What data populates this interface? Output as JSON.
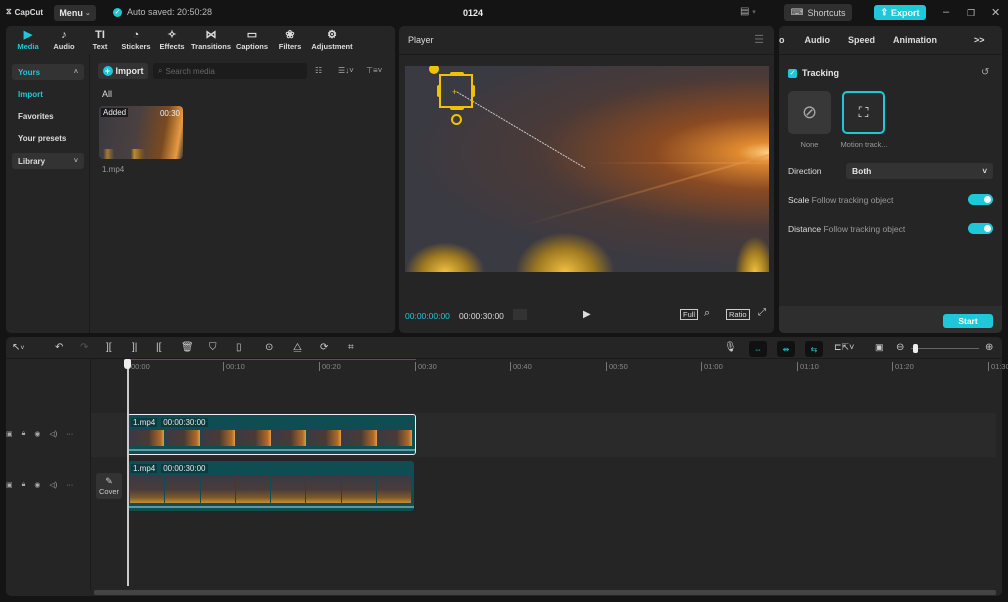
{
  "app": {
    "logo": "CapCut",
    "menu_label": "Menu",
    "autosave": "Auto saved: 20:50:28",
    "project_title": "0124",
    "shortcuts_label": "Shortcuts",
    "export_label": "Export"
  },
  "toolbar_tabs": [
    {
      "label": "Media",
      "icon": "▶"
    },
    {
      "label": "Audio",
      "icon": "♪"
    },
    {
      "label": "Text",
      "icon": "TI"
    },
    {
      "label": "Stickers",
      "icon": "◔"
    },
    {
      "label": "Effects",
      "icon": "✧"
    },
    {
      "label": "Transitions",
      "icon": "⋈"
    },
    {
      "label": "Captions",
      "icon": "▭"
    },
    {
      "label": "Filters",
      "icon": "❀"
    },
    {
      "label": "Adjustment",
      "icon": "⚙"
    }
  ],
  "media_sidebar": {
    "yours": "Yours",
    "import": "Import",
    "favorites": "Favorites",
    "presets": "Your presets",
    "library": "Library"
  },
  "media": {
    "import_label": "Import",
    "search_placeholder": "Search media",
    "filter_label": "All",
    "items": [
      {
        "name": "1.mp4",
        "badge": "Added",
        "duration": "00:30"
      }
    ]
  },
  "player": {
    "title": "Player",
    "current_time": "00:00:00:00",
    "total_time": "00:00:30:00",
    "full_label": "Full",
    "ratio_label": "Ratio"
  },
  "detail": {
    "tabs": [
      "o",
      "Audio",
      "Speed",
      "Animation"
    ],
    "more": ">>",
    "tracking_label": "Tracking",
    "tracking_enabled": true,
    "options": [
      {
        "label": "None",
        "selected": false
      },
      {
        "label": "Motion track...",
        "selected": true
      }
    ],
    "direction_label": "Direction",
    "direction_value": "Both",
    "scale_label": "Scale",
    "scale_sub": "Follow tracking object",
    "scale_on": true,
    "distance_label": "Distance",
    "distance_sub": "Follow tracking object",
    "distance_on": true,
    "start_label": "Start"
  },
  "timeline": {
    "ticks": [
      "00:00",
      "00:10",
      "00:20",
      "00:30",
      "00:40",
      "00:50",
      "01:00",
      "01:10",
      "01:20",
      "01:30"
    ],
    "clips": [
      {
        "name": "1.mp4",
        "duration": "00:00:30:00"
      },
      {
        "name": "1.mp4",
        "duration": "00:00:30:00"
      }
    ],
    "cover_label": "Cover"
  }
}
